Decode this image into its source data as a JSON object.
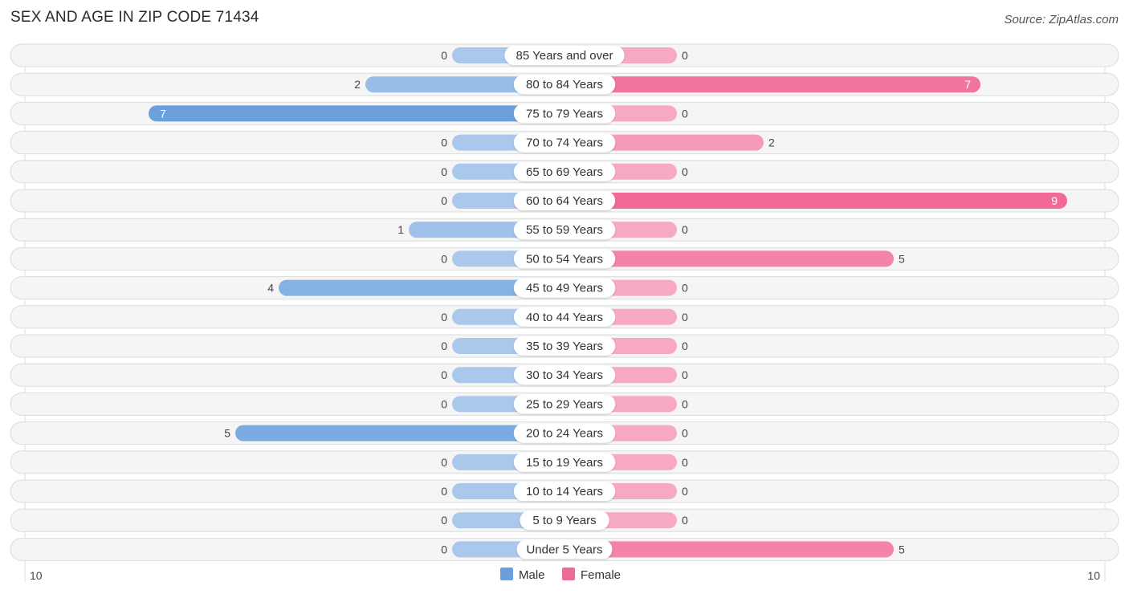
{
  "chart_data": {
    "type": "bar",
    "orientation": "horizontal-diverging",
    "title": "SEX AND AGE IN ZIP CODE 71434",
    "source": "Source: ZipAtlas.com",
    "categories": [
      "85 Years and over",
      "80 to 84 Years",
      "75 to 79 Years",
      "70 to 74 Years",
      "65 to 69 Years",
      "60 to 64 Years",
      "55 to 59 Years",
      "50 to 54 Years",
      "45 to 49 Years",
      "40 to 44 Years",
      "35 to 39 Years",
      "30 to 34 Years",
      "25 to 29 Years",
      "20 to 24 Years",
      "15 to 19 Years",
      "10 to 14 Years",
      "5 to 9 Years",
      "Under 5 Years"
    ],
    "series": [
      {
        "name": "Male",
        "color": "#6a9fdc",
        "values": [
          0,
          2,
          7,
          0,
          0,
          0,
          1,
          0,
          4,
          0,
          0,
          0,
          0,
          5,
          0,
          0,
          0,
          0
        ]
      },
      {
        "name": "Female",
        "color": "#f06a95",
        "values": [
          0,
          7,
          0,
          2,
          0,
          9,
          0,
          5,
          0,
          0,
          0,
          0,
          0,
          0,
          0,
          0,
          0,
          5
        ]
      }
    ],
    "axis": {
      "left_tick": "10",
      "right_tick": "10",
      "max": 10
    },
    "legend": {
      "position": "bottom-center",
      "items": [
        "Male",
        "Female"
      ]
    },
    "colors": {
      "male_strong": "#6a9fdc",
      "male_light": "#a9c8ec",
      "female_strong": "#f06a95",
      "female_light": "#f7a9c2",
      "row_bg": "#f5f5f5"
    }
  }
}
